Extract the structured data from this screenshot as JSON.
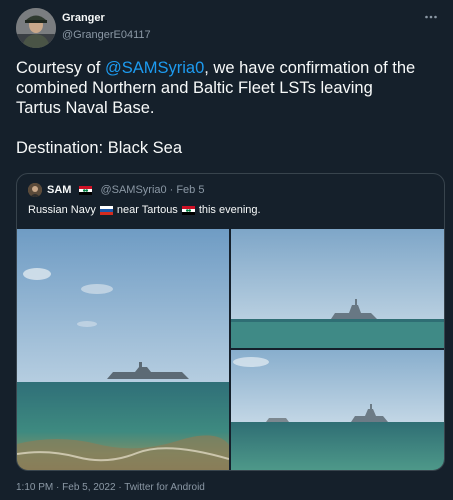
{
  "author": {
    "name": "Granger",
    "handle": "@GrangerE04117",
    "more_icon": "more-horizontal-icon"
  },
  "tweet": {
    "line1_prefix": "Courtesy of ",
    "mention": "@SAMSyria0",
    "line1_suffix": ", we have confirmation of the",
    "line2": "combined Northern and Baltic Fleet LSTs leaving",
    "line3": "Tartus Naval Base.",
    "line4": "Destination: Black Sea"
  },
  "quote": {
    "name": "SAM",
    "handle": "@SAMSyria0",
    "separator": "·",
    "date": "Feb 5",
    "text_part1": "Russian Navy",
    "text_part2": "near Tartous",
    "text_part3": "this evening.",
    "photos": [
      {
        "description_icon": "photo-ship-sea-left"
      },
      {
        "description_icon": "photo-ship-top-right"
      },
      {
        "description_icon": "photo-ships-bottom-right"
      }
    ]
  },
  "meta": {
    "time": "1:10 PM",
    "separator1": "·",
    "date": "Feb 5, 2022",
    "separator2": "·",
    "client": "Twitter for Android"
  },
  "colors": {
    "background": "#15202b",
    "text": "#f7f9f9",
    "secondary": "#8b98a5",
    "link": "#1d9bf0",
    "border": "#38444d"
  }
}
